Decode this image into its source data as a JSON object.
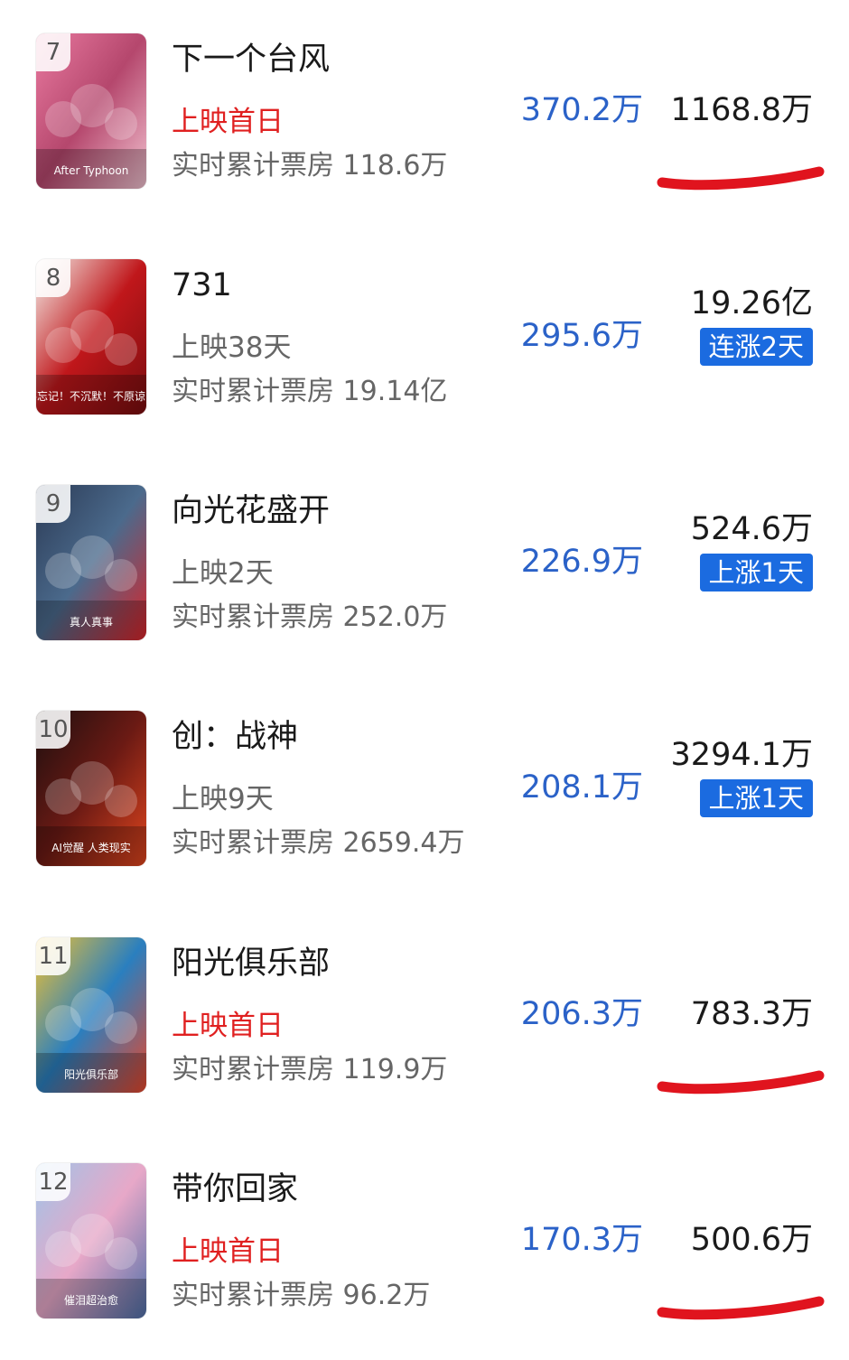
{
  "colors": {
    "today_blue": "#2b62c8",
    "first_day_red": "#e02020",
    "badge_blue": "#1b6be0",
    "annotation_red": "#e0141e"
  },
  "films": [
    {
      "rank": "7",
      "title": "下一个台风",
      "status": "上映首日",
      "status_first_day": true,
      "cumulative": "实时累计票房 118.6万",
      "today": "370.2万",
      "total": "1168.8万",
      "badge": "",
      "underlined": true,
      "poster_text": "After Typhoon",
      "poster_colors": [
        "#e97aa0",
        "#b5476d",
        "#f2c2d0"
      ]
    },
    {
      "rank": "8",
      "title": "731",
      "status": "上映38天",
      "status_first_day": false,
      "cumulative": "实时累计票房 19.14亿",
      "today": "295.6万",
      "total": "19.26亿",
      "badge": "连涨2天",
      "underlined": false,
      "poster_text": "不忘记！不沉默！不原谅！",
      "poster_colors": [
        "#f5f1ec",
        "#c0171b",
        "#7a0d0f"
      ]
    },
    {
      "rank": "9",
      "title": "向光花盛开",
      "status": "上映2天",
      "status_first_day": false,
      "cumulative": "实时累计票房 252.0万",
      "today": "226.9万",
      "total": "524.6万",
      "badge": "上涨1天",
      "underlined": false,
      "poster_text": "真人真事",
      "poster_colors": [
        "#2b3a55",
        "#4b6a8c",
        "#d9252a"
      ]
    },
    {
      "rank": "10",
      "title": "创：战神",
      "status": "上映9天",
      "status_first_day": false,
      "cumulative": "实时累计票房 2659.4万",
      "today": "208.1万",
      "total": "3294.1万",
      "badge": "上涨1天",
      "underlined": false,
      "poster_text": "AI觉醒 人类现实",
      "poster_colors": [
        "#1c0f0f",
        "#6b1a14",
        "#e0451e"
      ]
    },
    {
      "rank": "11",
      "title": "阳光俱乐部",
      "status": "上映首日",
      "status_first_day": true,
      "cumulative": "实时累计票房 119.9万",
      "today": "206.3万",
      "total": "783.3万",
      "badge": "",
      "underlined": true,
      "poster_text": "阳光俱乐部",
      "poster_colors": [
        "#f2c230",
        "#2a7fbf",
        "#e8472b"
      ]
    },
    {
      "rank": "12",
      "title": "带你回家",
      "status": "上映首日",
      "status_first_day": true,
      "cumulative": "实时累计票房 96.2万",
      "today": "170.3万",
      "total": "500.6万",
      "badge": "",
      "underlined": true,
      "poster_text": "催泪超治愈",
      "poster_colors": [
        "#9fc4e8",
        "#e7a8c8",
        "#4f6fa8"
      ]
    }
  ]
}
